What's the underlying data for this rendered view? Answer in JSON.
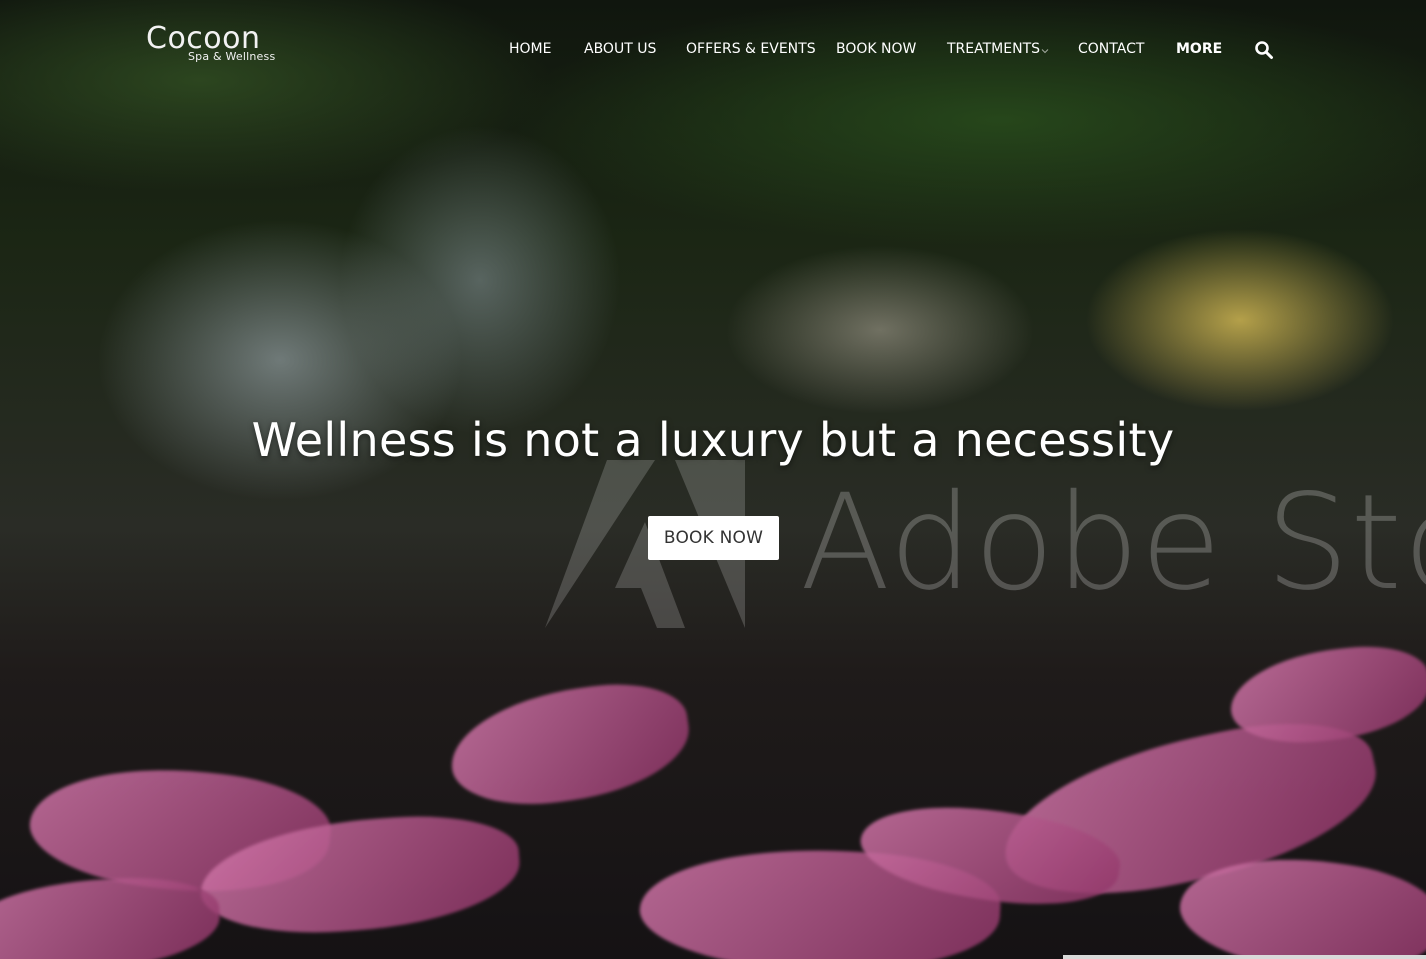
{
  "brand": {
    "name": "Cocoon",
    "tagline": "Spa & Wellness"
  },
  "nav": {
    "items": [
      {
        "label": "HOME"
      },
      {
        "label": "ABOUT US"
      },
      {
        "label": "OFFERS & EVENTS"
      },
      {
        "label": "BOOK NOW"
      },
      {
        "label": "TREATMENTS",
        "has_dropdown": true
      },
      {
        "label": "CONTACT"
      },
      {
        "label": "MORE",
        "bold": true
      }
    ],
    "search_icon": "search-icon",
    "dropdown_icon": "chevron-down-icon"
  },
  "hero": {
    "headline": "Wellness is not a luxury but a necessity",
    "cta_label": "BOOK NOW",
    "watermark_text": "Adobe Stock"
  },
  "colors": {
    "text": "#ffffff",
    "button_bg": "#ffffff",
    "button_text": "#333333",
    "petal": "#c0649a"
  }
}
